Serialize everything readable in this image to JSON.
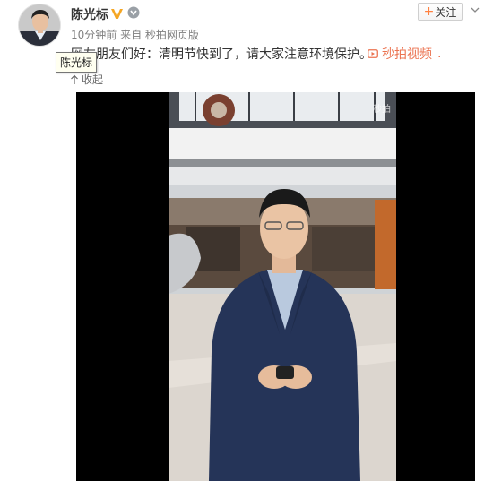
{
  "post": {
    "author_name": "陈光标",
    "timestamp": "10分钟前",
    "source": "来自 秒拍网页版",
    "text": "网友朋友们好：清明节快到了，请大家注意环境保护。",
    "video_link_label": "秒拍视频",
    "video_link_suffix": ".",
    "collapse_label": "收起",
    "tooltip": "陈光标"
  },
  "actions": {
    "follow_label": "关注",
    "follow_plus": "+"
  },
  "video": {
    "watermark": "秒拍"
  },
  "colors": {
    "accent": "#eb7350",
    "follow_plus": "#ff8140",
    "verified_badge": "#f5a623"
  }
}
